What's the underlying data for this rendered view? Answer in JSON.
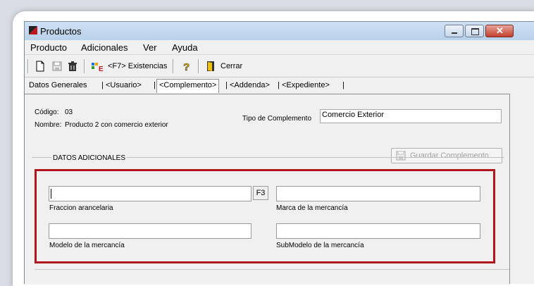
{
  "window": {
    "title": "Productos"
  },
  "menu": [
    "Producto",
    "Adicionales",
    "Ver",
    "Ayuda"
  ],
  "toolbar": {
    "existencias_label": "<F7> Existencias",
    "cerrar_label": "Cerrar"
  },
  "tabs": [
    "Datos Generales",
    "<Usuario>",
    "<Complemento>",
    "<Addenda>",
    "<Expediente>"
  ],
  "active_tab": "<Complemento>",
  "product": {
    "codigo_label": "Código:",
    "codigo_value": "03",
    "nombre_label": "Nombre:",
    "nombre_value": "Producto 2 con comercio exterior"
  },
  "complemento": {
    "tipo_label": "Tipo de Complemento",
    "tipo_value": "Comercio Exterior"
  },
  "guardar_label": "Guardar Complemento",
  "datos_adicionales": {
    "title": "DATOS ADICIONALES",
    "f3_label": "F3",
    "fraccion_label": "Fraccion arancelaria",
    "marca_label": "Marca de la mercancía",
    "modelo_label": "Modelo de la mercancía",
    "submodelo_label": "SubModelo de la mercancía",
    "fraccion_value": "",
    "marca_value": "",
    "modelo_value": "",
    "submodelo_value": ""
  },
  "colors": {
    "highlight": "#b0161b",
    "titlebar": "#b9d1ea",
    "close_button": "#c4402f"
  }
}
